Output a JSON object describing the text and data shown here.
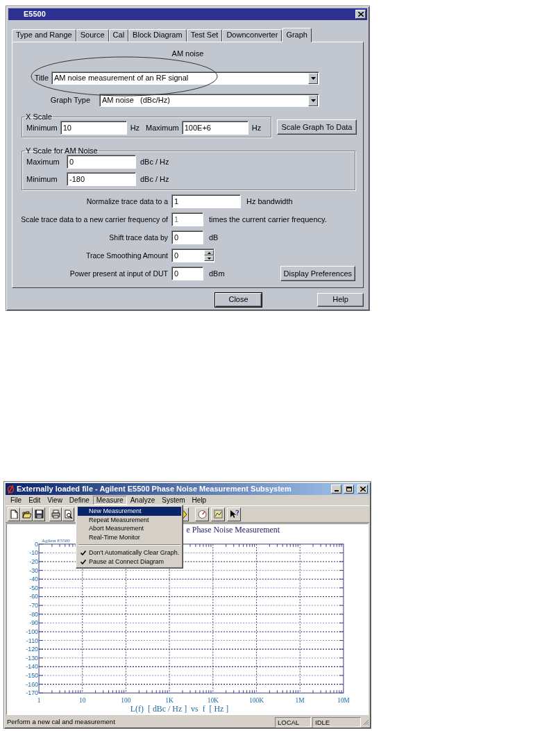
{
  "dialog": {
    "title": "E5500",
    "tabs": [
      {
        "label": "Type and Range",
        "selected": false
      },
      {
        "label": "Source",
        "selected": false
      },
      {
        "label": "Cal",
        "selected": false
      },
      {
        "label": "Block Diagram",
        "selected": false
      },
      {
        "label": "Test Set",
        "selected": false
      },
      {
        "label": "Downconverter",
        "selected": false
      },
      {
        "label": "Graph",
        "selected": true
      }
    ],
    "heading": "AM noise",
    "title_combo": {
      "label": "Title",
      "value": "AM noise measurement of an RF signal"
    },
    "graph_type_combo": {
      "label": "Graph Type",
      "value": "AM noise   (dBc/Hz)"
    },
    "x_scale": {
      "legend": "X Scale",
      "fields": [
        {
          "label": "Minimum",
          "value": "10",
          "unit": "Hz"
        },
        {
          "label": "Maximum",
          "value": "100E+6",
          "unit": "Hz"
        }
      ]
    },
    "scale_button": "Scale Graph To Data",
    "y_scale": {
      "legend": "Y Scale for AM Noise",
      "fields": [
        {
          "label": "Maximum",
          "value": "0",
          "unit": "dBc / Hz"
        },
        {
          "label": "Minimum",
          "value": "-180",
          "unit": "dBc / Hz"
        }
      ]
    },
    "settings": [
      {
        "kind": "wide",
        "label": "Normalize trace data to a",
        "value": "1",
        "unit": "Hz bandwidth",
        "disabled": false
      },
      {
        "kind": "text",
        "label": "Scale trace data to a new carrier frequency of",
        "value": "1",
        "unit": "times the current carrier frequency.",
        "disabled": true
      },
      {
        "kind": "text",
        "label": "Shift trace data by",
        "value": "0",
        "unit": "dB",
        "disabled": false
      },
      {
        "kind": "spinner",
        "label": "Trace Smoothing Amount",
        "value": "0",
        "disabled": false
      },
      {
        "kind": "text",
        "label": "Power present at input of DUT",
        "value": "0",
        "unit": "dBm",
        "disabled": false
      }
    ],
    "preferences_button": "Display Preferences",
    "footer_buttons": [
      {
        "label": "Close",
        "default": true
      },
      {
        "label": "Help",
        "default": false
      }
    ]
  },
  "app": {
    "title": "Externally loaded file - Agilent E5500 Phase Noise Measurement Subsystem",
    "menu_bar": [
      {
        "label": "File",
        "selected": false
      },
      {
        "label": "Edit",
        "selected": false
      },
      {
        "label": "View",
        "selected": false
      },
      {
        "label": "Define",
        "selected": false
      },
      {
        "label": "Measure",
        "selected": true
      },
      {
        "label": "Analyze",
        "selected": false
      },
      {
        "label": "System",
        "selected": false
      },
      {
        "label": "Help",
        "selected": false
      }
    ],
    "menu": [
      {
        "kind": "command",
        "label": "New Measurement",
        "selected": true,
        "checked": false
      },
      {
        "kind": "command",
        "label": "Repeat Measurement",
        "selected": false,
        "checked": false
      },
      {
        "kind": "command",
        "label": "Abort Measurement",
        "selected": false,
        "checked": false
      },
      {
        "kind": "command",
        "label": "Real-Time Monitor",
        "selected": false,
        "checked": false
      },
      {
        "kind": "separator"
      },
      {
        "kind": "command",
        "label": "Don't Automatically Clear Graph.",
        "selected": false,
        "checked": true
      },
      {
        "kind": "command",
        "label": "Pause at Connect Diagram",
        "selected": false,
        "checked": true
      }
    ],
    "graph": {
      "instrument_label": "Agilent E5500",
      "chart_data": {
        "type": "line",
        "grid": true,
        "title": "e Phase Noise Measurement",
        "xlabel": "L(f)  [ dBc / Hz ]  vs  f  [ Hz ]",
        "ylim": [
          -170,
          0
        ],
        "categories": [
          "1",
          "10",
          "100",
          "1K",
          "10K",
          "100K",
          "1M",
          "10M"
        ],
        "yticks": [
          0,
          -10,
          -20,
          -30,
          -40,
          -50,
          -60,
          -70,
          -80,
          -90,
          -100,
          -110,
          -120,
          -130,
          -140,
          -150,
          -160,
          -170
        ]
      }
    },
    "status_bar": {
      "message": "Perform a new cal and measurement",
      "panels": [
        "LOCAL",
        "IDLE"
      ]
    }
  }
}
